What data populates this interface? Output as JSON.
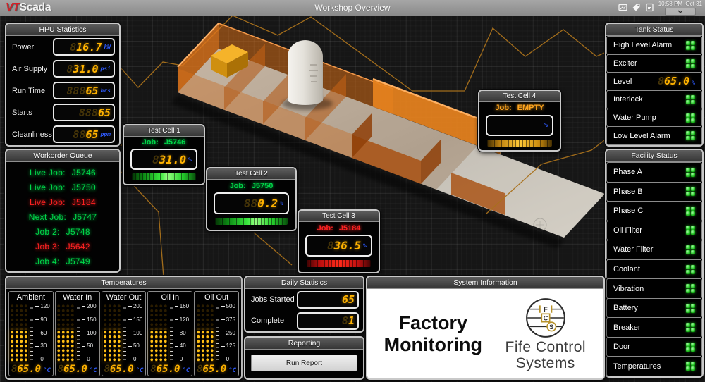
{
  "titlebar": {
    "brand_vt": "VT",
    "brand_scada": "Scada",
    "title": "Workshop Overview",
    "clock": "10:58 PM  Oct 31",
    "icons": [
      "page-icon",
      "tag-icon",
      "notes-icon"
    ]
  },
  "hpu": {
    "title": "HPU Statistics",
    "rows": [
      {
        "label": "Power",
        "ghost": "8",
        "value": "16.7",
        "unit": "kW"
      },
      {
        "label": "Air Supply",
        "ghost": "8",
        "value": "31.0",
        "unit": "psi"
      },
      {
        "label": "Run Time",
        "ghost": "888",
        "value": "65",
        "unit": "hrs"
      },
      {
        "label": "Starts",
        "ghost": "888",
        "value": "65",
        "unit": ""
      },
      {
        "label": "Cleanliness",
        "ghost": "88",
        "value": "65",
        "unit": "ppm"
      }
    ]
  },
  "workorder": {
    "title": "Workorder Queue",
    "items": [
      {
        "label": "Live Job:",
        "value": "J5746",
        "color": "#00d84a"
      },
      {
        "label": "Live Job:",
        "value": "J5750",
        "color": "#00d84a"
      },
      {
        "label": "Live Job:",
        "value": "J5184",
        "color": "#ff2222"
      },
      {
        "label": "Next Job:",
        "value": "J5747",
        "color": "#00d84a"
      },
      {
        "label": "Job 2:",
        "value": "J5748",
        "color": "#00d84a"
      },
      {
        "label": "Job 3:",
        "value": "J5642",
        "color": "#ff2222"
      },
      {
        "label": "Job 4:",
        "value": "J5749",
        "color": "#00d84a"
      }
    ]
  },
  "test_cells": [
    {
      "title": "Test Cell 1",
      "job_label": "Job:",
      "job": "J5746",
      "job_color": "#00d84a",
      "ghost": "8",
      "value": "31.0",
      "unit": "%",
      "bar_fill": "100%"
    },
    {
      "title": "Test Cell 2",
      "job_label": "Job:",
      "job": "J5750",
      "job_color": "#00d84a",
      "ghost": "88",
      "value": "0.2",
      "unit": "%",
      "bar_fill": "100%"
    },
    {
      "title": "Test Cell 3",
      "job_label": "Job:",
      "job": "J5184",
      "job_color": "#ff2222",
      "ghost": "8",
      "value": "36.5",
      "unit": "%",
      "bar_fill": "100%"
    },
    {
      "title": "Test Cell 4",
      "job_label": "Job:",
      "job": "EMPTY",
      "job_color": "#ffa51e",
      "ghost": "",
      "value": "",
      "unit": "%",
      "bar_fill": "100%"
    }
  ],
  "tank": {
    "title": "Tank Status",
    "rows": [
      {
        "label": "High Level Alarm",
        "type": "led"
      },
      {
        "label": "Exciter",
        "type": "led"
      },
      {
        "label": "Level",
        "type": "value",
        "ghost": "8",
        "value": "65.0",
        "unit": "%"
      },
      {
        "label": "Interlock",
        "type": "led"
      },
      {
        "label": "Water Pump",
        "type": "led"
      },
      {
        "label": "Low Level Alarm",
        "type": "led"
      }
    ]
  },
  "facility": {
    "title": "Facility Status",
    "items": [
      "Phase A",
      "Phase B",
      "Phase C",
      "Oil Filter",
      "Water Filter",
      "Coolant",
      "Vibration",
      "Battery",
      "Breaker",
      "Door",
      "Temperatures"
    ]
  },
  "temperatures": {
    "title": "Temperatures",
    "unit": "°C",
    "gauges": [
      {
        "name": "Ambient",
        "ticks": [
          "120",
          "90",
          "60",
          "30",
          "0"
        ],
        "ghost": "8",
        "value": "65.0",
        "fill": "55%"
      },
      {
        "name": "Water In",
        "ticks": [
          "200",
          "150",
          "100",
          "50",
          "0"
        ],
        "ghost": "8",
        "value": "65.0",
        "fill": "55%"
      },
      {
        "name": "Water Out",
        "ticks": [
          "200",
          "150",
          "100",
          "50",
          "0"
        ],
        "ghost": "8",
        "value": "65.0",
        "fill": "55%"
      },
      {
        "name": "Oil In",
        "ticks": [
          "160",
          "120",
          "80",
          "40",
          "0"
        ],
        "ghost": "8",
        "value": "65.0",
        "fill": "55%"
      },
      {
        "name": "Oil Out",
        "ticks": [
          "500",
          "375",
          "250",
          "125",
          "0"
        ],
        "ghost": "8",
        "value": "65.0",
        "fill": "55%"
      }
    ]
  },
  "daily": {
    "title": "Daily Statisics",
    "rows": [
      {
        "label": "Jobs Started",
        "ghost": "",
        "value": "65"
      },
      {
        "label": "Complete",
        "ghost": "8",
        "value": "1"
      }
    ]
  },
  "reporting": {
    "title": "Reporting",
    "button": "Run Report"
  },
  "system_info": {
    "title": "System Information",
    "heading_line1": "Factory",
    "heading_line2": "Monitoring",
    "brand_line1": "Fife Control",
    "brand_line2": "Systems"
  },
  "colors": {
    "seg_amber": "#ffb200",
    "seg_ghost": "#453408",
    "unit_blue": "#2e5bff",
    "led_green": "#1cba1c",
    "job_green": "#00d84a",
    "job_red": "#ff2222",
    "job_amber": "#ffa51e",
    "bar_green": "#3ae83e",
    "bar_red": "#ff2b1a",
    "bar_amber": "#ffc938",
    "trace_orange": "#a9711b",
    "wall_orange": "#e8831e",
    "titlebar_gray": "#8a8a8a"
  }
}
